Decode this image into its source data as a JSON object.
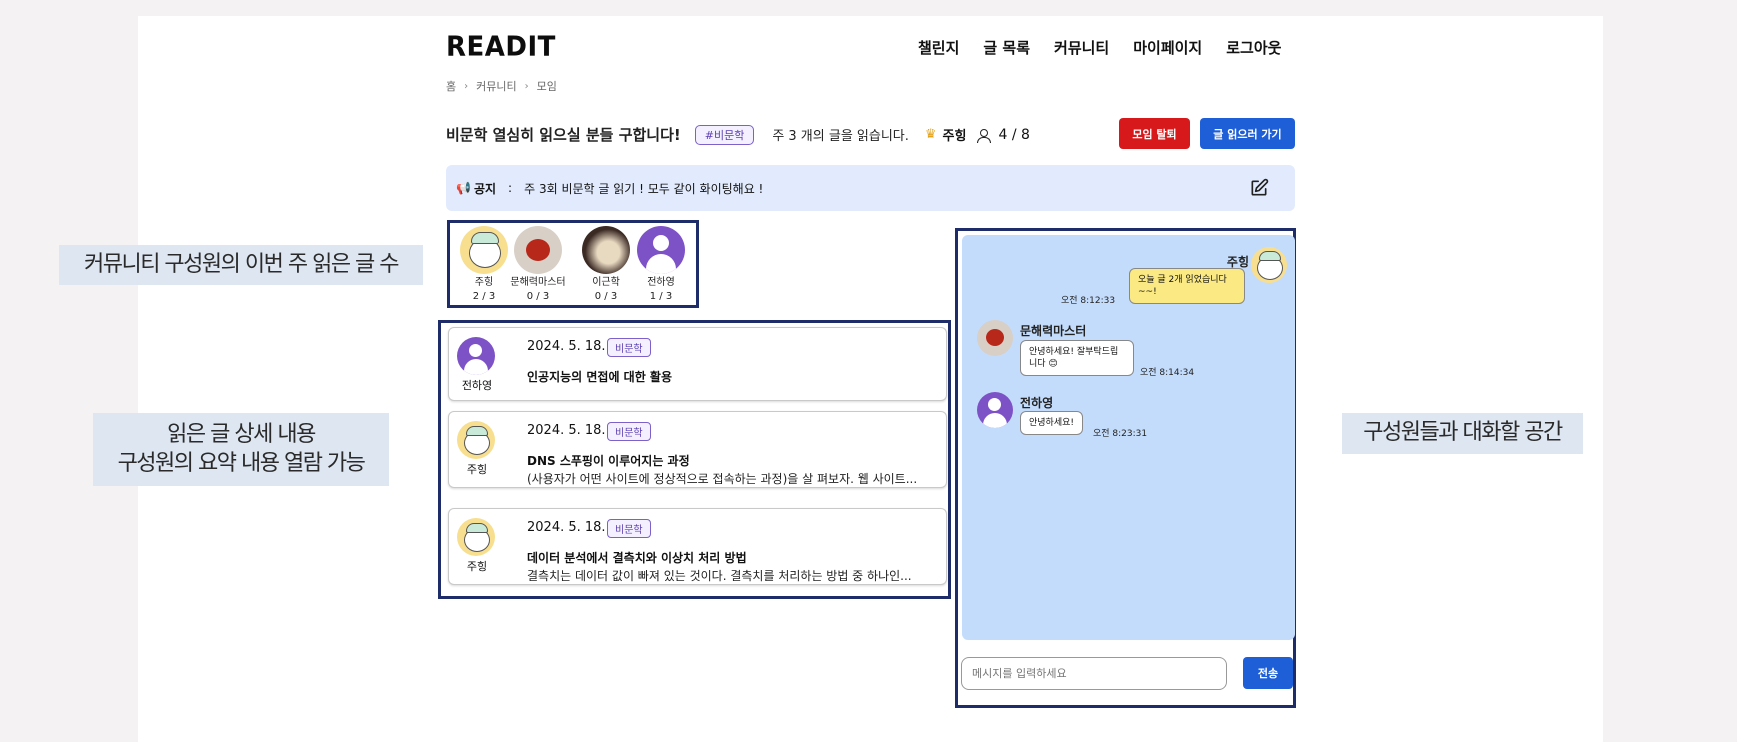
{
  "header": {
    "logo": "READIT",
    "nav": [
      "챌린지",
      "글 목록",
      "커뮤니티",
      "마이페이지",
      "로그아웃"
    ]
  },
  "breadcrumb": [
    "홈",
    "커뮤니티",
    "모임"
  ],
  "group": {
    "title": "비문학 열심히 읽으실 분들 구합니다!",
    "tag": "#비문학",
    "weekly_goal": "주 3 개의 글을 읽습니다.",
    "leader": "주힝",
    "member_count": "4 / 8",
    "leave_button": "모임 탈퇴",
    "read_button": "글 읽으러 가기"
  },
  "notice": {
    "label": "공지",
    "colon": ":",
    "text": "주 3회 비문학 글 읽기 ! 모두 같이 화이팅해요 !"
  },
  "members": [
    {
      "name": "주힝",
      "progress": "2 / 3",
      "avatar": "bear-avatar"
    },
    {
      "name": "문해력마스터",
      "progress": "0 / 3",
      "avatar": "tomato-avatar"
    },
    {
      "name": "이근학",
      "progress": "0 / 3",
      "avatar": "food-avatar"
    },
    {
      "name": "전하영",
      "progress": "1 / 3",
      "avatar": "default-avatar"
    }
  ],
  "posts": [
    {
      "author": "전하영",
      "date": "2024. 5. 18.",
      "tag": "비문학",
      "title": "인공지능의 면접에 대한 활용",
      "summary": "",
      "avatar": "default-avatar"
    },
    {
      "author": "주힝",
      "date": "2024. 5. 18.",
      "tag": "비문학",
      "title": "DNS 스푸핑이 이루어지는 과정",
      "summary": "(사용자가 어떤 사이트에 정상적으로 접속하는 과정)을 살 펴보자. 웹 사이트...",
      "avatar": "bear-avatar"
    },
    {
      "author": "주힝",
      "date": "2024. 5. 18.",
      "tag": "비문학",
      "title": "데이터 분석에서 결측치와 이상치 처리 방법",
      "summary": "결측치는 데이터 값이 빠져 있는 것이다. 결측치를 처리하는 방법 중 하나인...",
      "avatar": "bear-avatar"
    }
  ],
  "chat": {
    "messages": [
      {
        "sender": "주힝",
        "text_line1": "오늘 글 2개 읽었습니다",
        "text_line2": "~~!",
        "time": "오전 8:12:33",
        "mine": true
      },
      {
        "sender": "문해력마스터",
        "text_line1": "안녕하세요! 잘부탁드립",
        "text_line2": "니다 😊",
        "time": "오전 8:14:34",
        "mine": false
      },
      {
        "sender": "전하영",
        "text_line1": "안녕하세요!",
        "text_line2": "",
        "time": "오전 8:23:31",
        "mine": false
      }
    ],
    "input_placeholder": "메시지를 입력하세요",
    "send_label": "전송"
  },
  "annotations": {
    "members_note": "커뮤니티 구성원의 이번 주 읽은 글 수",
    "posts_note_line1": "읽은 글 상세 내용",
    "posts_note_line2": "구성원의 요약 내용  열람 가능",
    "chat_note": "구성원들과 대화할 공간"
  },
  "colors": {
    "accent_blue": "#1e5fd8",
    "danger_red": "#d7191c",
    "highlight_border": "#1e2d6a",
    "chat_background": "#c4dcfb",
    "notice_background": "#e1ebfd",
    "tag_purple": "#7b61c9"
  }
}
